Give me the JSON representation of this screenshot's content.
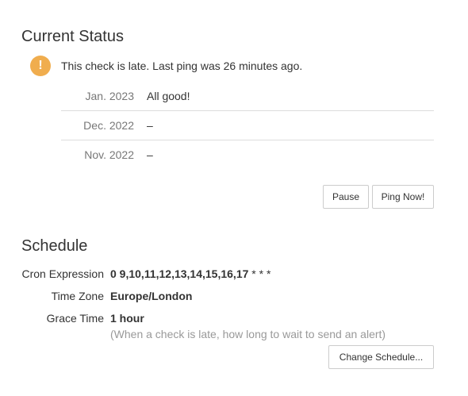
{
  "current_status": {
    "title": "Current Status",
    "icon": "exclamation-circle-icon",
    "icon_glyph": "!",
    "icon_color": "#f0ad4e",
    "message": "This check is late. Last ping was 26 minutes ago.",
    "history": [
      {
        "date": "Jan. 2023",
        "value": "All good!"
      },
      {
        "date": "Dec. 2022",
        "value": "–"
      },
      {
        "date": "Nov. 2022",
        "value": "–"
      }
    ],
    "buttons": {
      "pause": "Pause",
      "ping_now": "Ping Now!"
    }
  },
  "schedule": {
    "title": "Schedule",
    "cron_label": "Cron Expression",
    "cron_value_bold": "0 9,10,11,12,13,14,15,16,17",
    "cron_value_rest": " * * *",
    "timezone_label": "Time Zone",
    "timezone_value": "Europe/London",
    "grace_label": "Grace Time",
    "grace_value": "1 hour",
    "grace_hint": "(When a check is late, how long to wait to send an alert)",
    "change_button": "Change Schedule..."
  }
}
